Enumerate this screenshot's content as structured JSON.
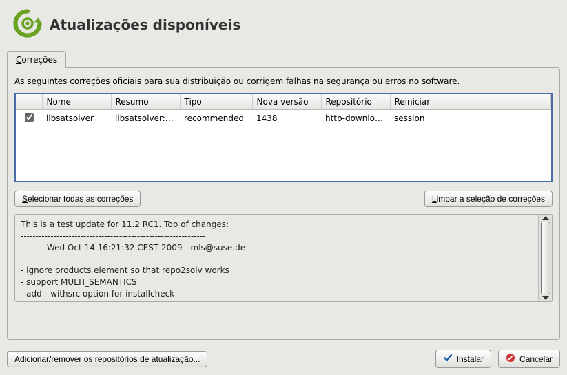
{
  "header": {
    "title": "Atualizações disponíveis"
  },
  "tabs": {
    "corrections": {
      "ul": "C",
      "rest": "orreções"
    }
  },
  "description": "As seguintes correções oficiais para sua distribuição ou corrigem falhas na segurança ou erros no software.",
  "table": {
    "headers": {
      "name": "Nome",
      "summary": "Resumo",
      "type": "Tipo",
      "newversion": "Nova versão",
      "repo": "Repositório",
      "restart": "Reiniciar"
    },
    "rows": [
      {
        "checked": true,
        "name": "libsatsolver",
        "summary": "libsatsolver: …",
        "type": "recommended",
        "newversion": "1438",
        "repo": "http-download…",
        "restart": "session"
      }
    ]
  },
  "buttons": {
    "select_all": {
      "ul": "S",
      "rest": "elecionar todas as correções"
    },
    "clear_sel": {
      "ul": "L",
      "rest": "impar a seleção de correções"
    },
    "add_repo": {
      "ul": "A",
      "rest": "dicionar/remover os repositórios de atualização..."
    },
    "install": {
      "ul": "I",
      "rest": "nstalar"
    },
    "cancel": {
      "ul": "C",
      "rest": "ancelar"
    }
  },
  "details": "This is a test update for 11.2 RC1. Top of changes:\n--------------------------------------------------------------\n ------- Wed Oct 14 16:21:32 CEST 2009 - mls@suse.de\n\n- ignore products element so that repo2solv works\n- support MULTI_SEMANTICS\n- add --withsrc option for installcheck"
}
